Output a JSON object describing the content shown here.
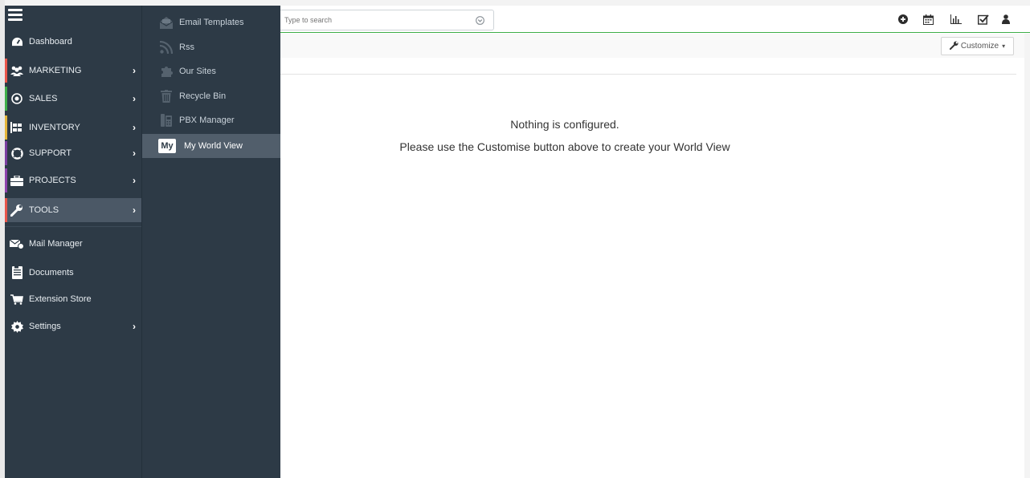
{
  "search": {
    "placeholder": "Type to search"
  },
  "toolbar": {
    "customize_label": "Customize"
  },
  "main": {
    "message_title": "Nothing is configured.",
    "message_body": "Please use the Customise button above to create your World View"
  },
  "sidebar": {
    "items": [
      {
        "label": "Dashboard",
        "icon": "dashboard-icon",
        "color": ""
      },
      {
        "label": "MARKETING",
        "icon": "users-icon",
        "color": "#e8564b"
      },
      {
        "label": "SALES",
        "icon": "target-icon",
        "color": "#3fae49"
      },
      {
        "label": "INVENTORY",
        "icon": "inventory-icon",
        "color": "#e3b53b"
      },
      {
        "label": "SUPPORT",
        "icon": "lifebuoy-icon",
        "color": "#7b3fa0"
      },
      {
        "label": "PROJECTS",
        "icon": "briefcase-icon",
        "color": "#8e44ad"
      },
      {
        "label": "TOOLS",
        "icon": "wrench-icon",
        "color": "#e8564b"
      },
      {
        "label": "Mail Manager",
        "icon": "mail-icon",
        "color": ""
      },
      {
        "label": "Documents",
        "icon": "document-icon",
        "color": ""
      },
      {
        "label": "Extension Store",
        "icon": "cart-icon",
        "color": ""
      },
      {
        "label": "Settings",
        "icon": "gear-icon",
        "color": ""
      }
    ]
  },
  "submenu": {
    "items": [
      {
        "label": "Email Templates",
        "icon": "email-template-icon"
      },
      {
        "label": "Rss",
        "icon": "rss-icon"
      },
      {
        "label": "Our Sites",
        "icon": "puzzle-icon"
      },
      {
        "label": "Recycle Bin",
        "icon": "trash-icon"
      },
      {
        "label": "PBX Manager",
        "icon": "pbx-icon"
      },
      {
        "label": "My World View",
        "icon": "my-badge-icon",
        "badge": "My"
      }
    ]
  }
}
